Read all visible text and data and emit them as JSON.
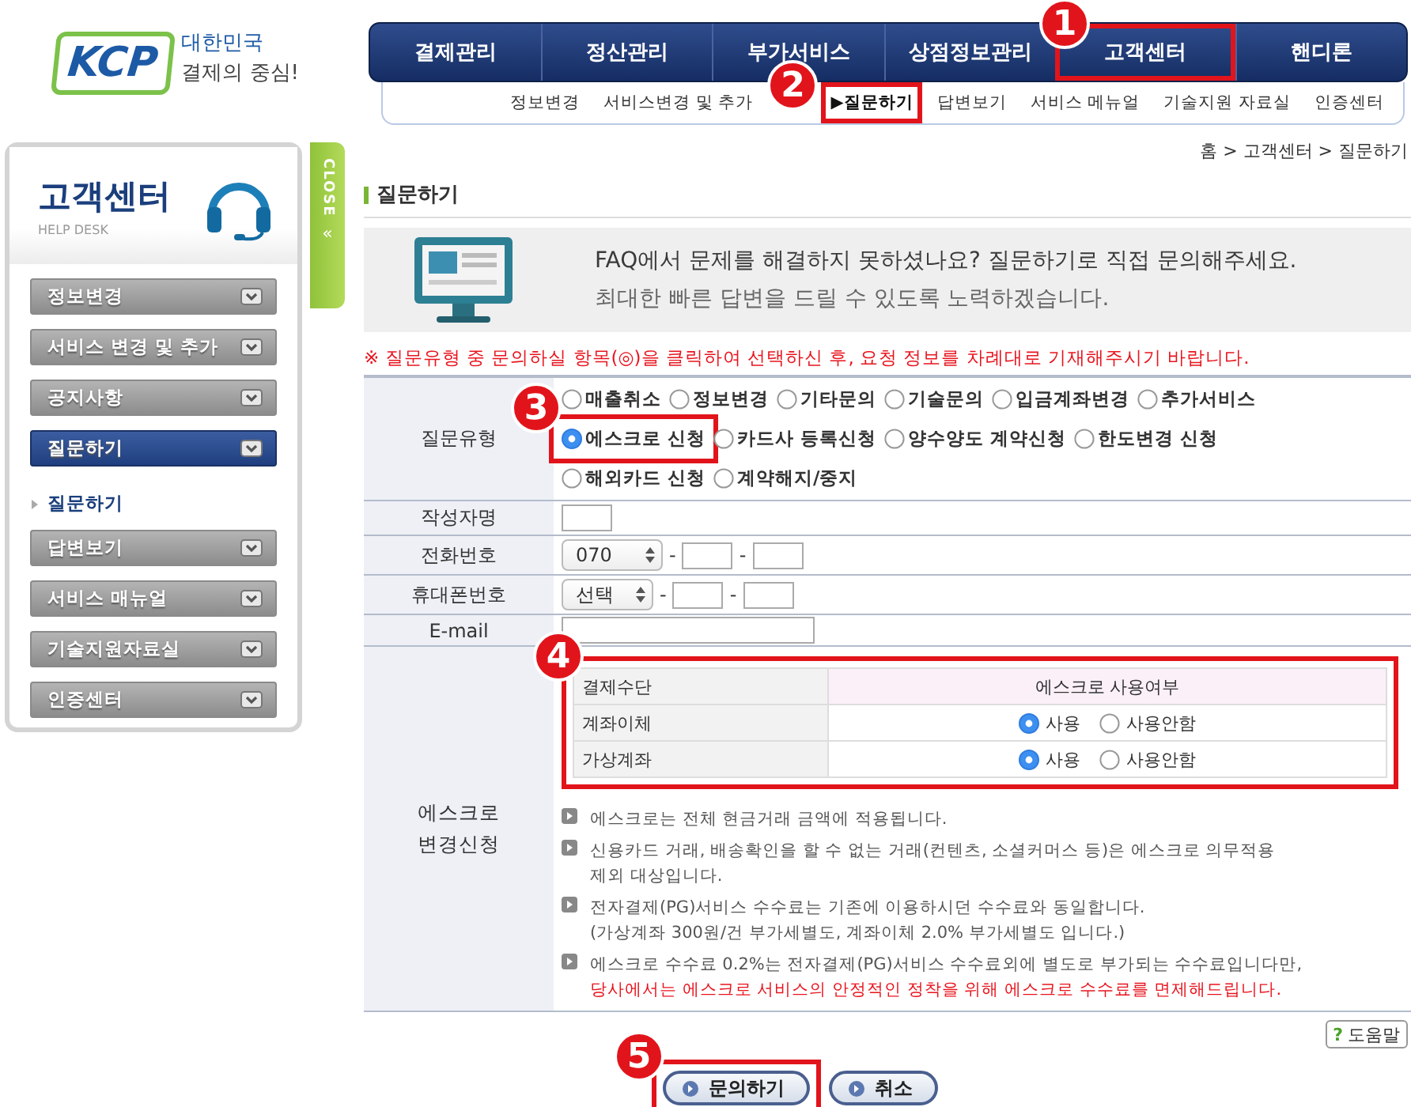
{
  "logo": {
    "brand": "KCP",
    "tagline_1": "대한민국",
    "tagline_2": "결제의 중심!"
  },
  "main_nav": [
    {
      "label": "결제관리"
    },
    {
      "label": "정산관리"
    },
    {
      "label": "부가서비스"
    },
    {
      "label": "상점정보관리"
    },
    {
      "label": "고객센터"
    },
    {
      "label": "핸디론"
    }
  ],
  "sub_nav": [
    {
      "label": "정보변경",
      "selected": false
    },
    {
      "label": "서비스변경 및 추가",
      "selected": false
    },
    {
      "label": "▶질문하기",
      "selected": true
    },
    {
      "label": "답변보기",
      "selected": false
    },
    {
      "label": "서비스 메뉴얼",
      "selected": false
    },
    {
      "label": "기술지원 자료실",
      "selected": false
    },
    {
      "label": "인증센터",
      "selected": false
    }
  ],
  "breadcrumb": "홈 > 고객센터 > 질문하기",
  "sidebar": {
    "title": "고객센터",
    "subtitle": "HELP DESK",
    "close_tab": "CLOSE",
    "close_arrow": "«",
    "items": [
      {
        "label": "정보변경",
        "selected": false
      },
      {
        "label": "서비스 변경 및 추가",
        "selected": false
      },
      {
        "label": "공지사항",
        "selected": false
      },
      {
        "label": "질문하기",
        "selected": true,
        "children": [
          {
            "label": "질문하기"
          }
        ]
      },
      {
        "label": "답변보기",
        "selected": false
      },
      {
        "label": "서비스 매뉴얼",
        "selected": false
      },
      {
        "label": "기술지원자료실",
        "selected": false
      },
      {
        "label": "인증센터",
        "selected": false
      }
    ]
  },
  "page_title": "질문하기",
  "banner": {
    "line_1": "FAQ에서 문제를 해결하지 못하셨나요? 질문하기로 직접 문의해주세요.",
    "line_2": "최대한 빠른 답변을 드릴 수 있도록 노력하겠습니다."
  },
  "notice": "※ 질문유형 중 문의하실 항목(◎)을 클릭하여 선택하신 후, 요청 정보를 차례대로 기재해주시기 바랍니다.",
  "form": {
    "question_type": {
      "label": "질문유형",
      "options": [
        {
          "label": "매출취소",
          "selected": false
        },
        {
          "label": "정보변경",
          "selected": false
        },
        {
          "label": "기타문의",
          "selected": false
        },
        {
          "label": "기술문의",
          "selected": false
        },
        {
          "label": "입금계좌변경",
          "selected": false
        },
        {
          "label": "추가서비스",
          "selected": false
        },
        {
          "label": "에스크로 신청",
          "selected": true
        },
        {
          "label": "카드사 등록신청",
          "selected": false
        },
        {
          "label": "양수양도 계약신청",
          "selected": false
        },
        {
          "label": "한도변경 신청",
          "selected": false
        },
        {
          "label": "해외카드 신청",
          "selected": false
        },
        {
          "label": "계약해지/중지",
          "selected": false
        }
      ]
    },
    "author": {
      "label": "작성자명"
    },
    "phone": {
      "label": "전화번호",
      "prefix": "070",
      "separator_1": "-",
      "separator_2": "-"
    },
    "mobile": {
      "label": "휴대폰번호",
      "prefix": "선택",
      "separator_1": "-",
      "separator_2": "-"
    },
    "email": {
      "label": "E-mail"
    },
    "escrow": {
      "label": "에스크로 변경신청",
      "columns": [
        "결제수단",
        "에스크로 사용여부"
      ],
      "rows": [
        {
          "method": "계좌이체",
          "options": [
            {
              "label": "사용",
              "selected": true
            },
            {
              "label": "사용안함",
              "selected": false
            }
          ]
        },
        {
          "method": "가상계좌",
          "options": [
            {
              "label": "사용",
              "selected": true
            },
            {
              "label": "사용안함",
              "selected": false
            }
          ]
        }
      ],
      "notes": [
        {
          "lines": [
            {
              "text": "에스크로는 전체 현금거래 금액에 적용됩니다.",
              "kind": "normal"
            }
          ]
        },
        {
          "lines": [
            {
              "text": "신용카드 거래, 배송확인을 할 수 없는 거래(컨텐츠, 소셜커머스 등)은 에스크로 의무적용",
              "kind": "normal"
            },
            {
              "text": "제외 대상입니다.",
              "kind": "normal"
            }
          ]
        },
        {
          "lines": [
            {
              "text": "전자결제(PG)서비스 수수료는 기존에 이용하시던 수수료와 동일합니다.",
              "kind": "normal"
            },
            {
              "text": "(가상계좌 300원/건 부가세별도, 계좌이체 2.0% 부가세별도 입니다.)",
              "kind": "normal"
            }
          ]
        },
        {
          "lines": [
            {
              "text": "에스크로 수수료 0.2%는 전자결제(PG)서비스 수수료외에 별도로 부가되는 수수료입니다만,",
              "kind": "normal"
            },
            {
              "text": "당사에서는 에스크로 서비스의 안정적인 정착을 위해 에스크로 수수료를 면제해드립니다.",
              "kind": "warning"
            }
          ]
        }
      ]
    }
  },
  "help_button": {
    "icon": "?",
    "label": "도움말"
  },
  "buttons": [
    {
      "label": "문의하기"
    },
    {
      "label": "취소"
    }
  ],
  "annotations": [
    {
      "number": "1"
    },
    {
      "number": "2"
    },
    {
      "number": "3"
    },
    {
      "number": "4"
    },
    {
      "number": "5"
    }
  ]
}
